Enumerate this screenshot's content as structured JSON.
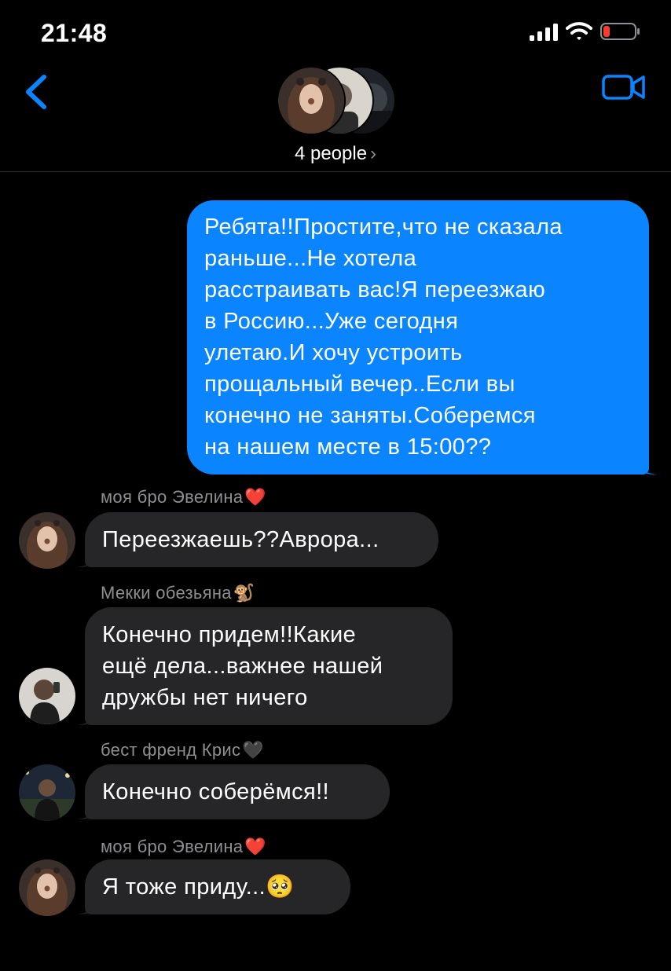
{
  "status": {
    "time": "21:48"
  },
  "header": {
    "group_label": "4 people",
    "chevron": "›"
  },
  "messages": {
    "outgoing": {
      "lines": [
        "Ребята!!Простите,что не сказала",
        "раньше...Не хотела",
        "расстраивать вас!Я переезжаю",
        "в Россию...Уже сегодня",
        "улетаю.И хочу устроить",
        "прощальный вечер..Если вы",
        "конечно не заняты.Соберемся",
        "на нашем месте в 15:00??"
      ]
    },
    "incoming": [
      {
        "sender": "моя бро Эвелина",
        "sender_emoji": "❤️",
        "lines": [
          "Переезжаешь??Аврора..."
        ]
      },
      {
        "sender": "Мекки обезьяна",
        "sender_emoji": "🐒",
        "lines": [
          "Конечно придем!!Какие",
          "ещё дела...важнее нашей",
          "дружбы нет ничего"
        ]
      },
      {
        "sender": "бест френд Крис",
        "sender_emoji": "🖤",
        "lines": [
          "Конечно соберёмся!!"
        ]
      },
      {
        "sender": "моя бро Эвелина",
        "sender_emoji": "❤️",
        "lines": [
          "Я тоже приду...🥺"
        ]
      }
    ]
  },
  "colors": {
    "accent": "#0a84ff",
    "incoming_bubble": "#262628",
    "sender_text": "#8e8e93",
    "battery_low": "#ff3b30"
  }
}
